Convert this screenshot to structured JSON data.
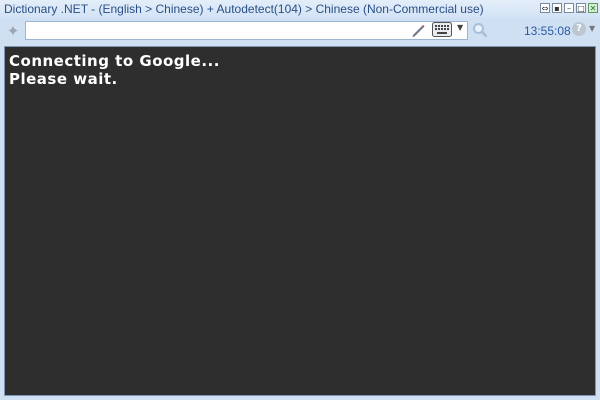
{
  "window": {
    "title": "Dictionary .NET - (English > Chinese) + Autodetect(104) > Chinese (Non-Commercial use)",
    "buttons": [
      "⇔",
      "▪",
      "–",
      "□",
      "✕"
    ]
  },
  "toolbar": {
    "search_value": "",
    "clock": "13:55:08",
    "help_glyph": "?",
    "dropdown_glyph": "▼"
  },
  "icons": {
    "left": "dictionary-icon",
    "pen": "pen-icon",
    "keyboard": "keyboard-icon",
    "search": "search-icon",
    "help": "help-icon"
  },
  "result": {
    "lines": [
      "Connecting to Google...",
      "Please wait."
    ]
  }
}
